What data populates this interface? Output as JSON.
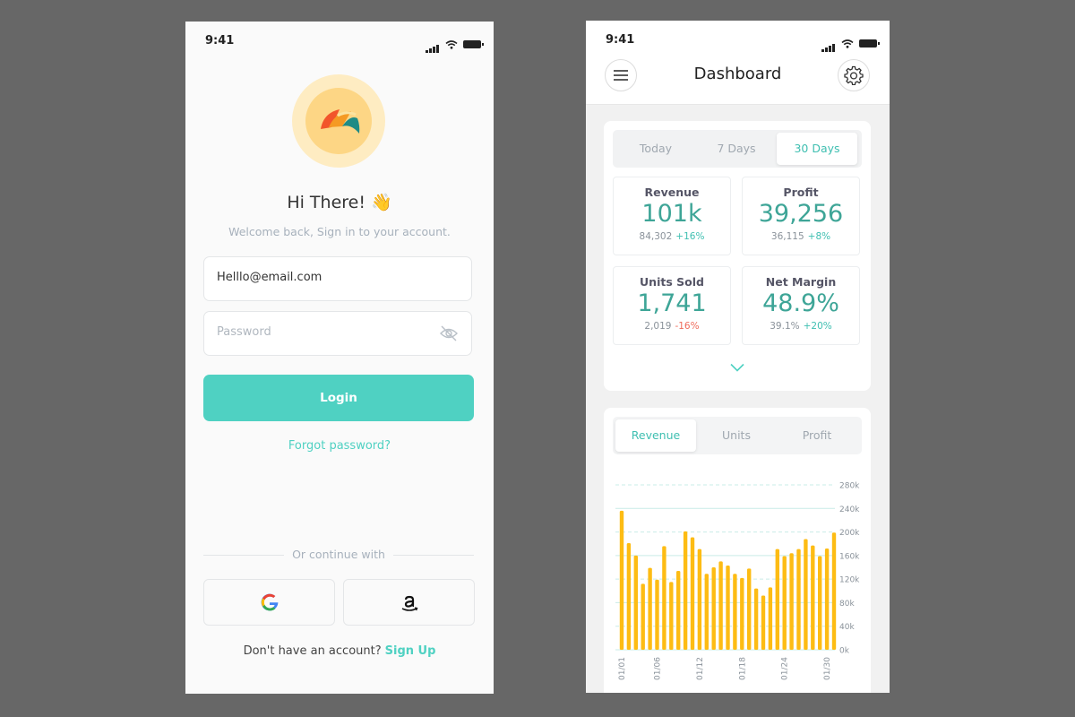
{
  "login": {
    "status": {
      "time": "9:41"
    },
    "greeting": "Hi There! 👋",
    "subtitle": "Welcome back, Sign in to your account.",
    "email_value": "Helllo@email.com",
    "password_placeholder": "Password",
    "login_label": "Login",
    "forgot_label": "Forgot password?",
    "divider_label": "Or continue with",
    "social": [
      "google-icon",
      "amazon-icon"
    ],
    "signup_prompt": "Don't have an account?",
    "signup_link": "Sign Up",
    "icons": {
      "password_toggle": "eye-off-icon"
    }
  },
  "dashboard": {
    "status": {
      "time": "9:41"
    },
    "title": "Dashboard",
    "icons": {
      "menu": "hamburger-menu-icon",
      "settings": "gear-icon",
      "expand": "chevron-down-icon"
    },
    "range_tabs": [
      "Today",
      "7 Days",
      "30 Days"
    ],
    "active_range": "30 Days",
    "stats": [
      {
        "label": "Revenue",
        "value": "101k",
        "previous": "84,302",
        "change": "+16%",
        "trend": "up"
      },
      {
        "label": "Profit",
        "value": "39,256",
        "previous": "36,115",
        "change": "+8%",
        "trend": "up"
      },
      {
        "label": "Units Sold",
        "value": "1,741",
        "previous": "2,019",
        "change": "-16%",
        "trend": "down"
      },
      {
        "label": "Net Margin",
        "value": "48.9%",
        "previous": "39.1%",
        "change": "+20%",
        "trend": "up"
      }
    ],
    "chart_tabs": [
      "Revenue",
      "Units",
      "Profit"
    ],
    "active_chart_tab": "Revenue"
  },
  "colors": {
    "accent": "#4fd1c2",
    "accent_dark": "#3ea597",
    "bar": "#fdbc14",
    "negative": "#ef6b5b"
  },
  "chart_data": {
    "type": "bar",
    "categories": [
      "01/01",
      "01/02",
      "01/03",
      "01/04",
      "01/05",
      "01/06",
      "01/07",
      "01/08",
      "01/09",
      "01/10",
      "01/11",
      "01/12",
      "01/13",
      "01/14",
      "01/15",
      "01/16",
      "01/17",
      "01/18",
      "01/19",
      "01/20",
      "01/21",
      "01/22",
      "01/23",
      "01/24",
      "01/25",
      "01/26",
      "01/27",
      "01/28",
      "01/29",
      "01/30"
    ],
    "x_tick_labels": [
      "01/01",
      "01/06",
      "01/12",
      "01/18",
      "01/24",
      "01/30"
    ],
    "values": [
      236000,
      181000,
      160000,
      112000,
      139000,
      119000,
      176000,
      115000,
      134000,
      201000,
      191000,
      171000,
      129000,
      140000,
      150000,
      143000,
      129000,
      122000,
      138000,
      104000,
      92000,
      106000,
      171000,
      159000,
      164000,
      171000,
      188000,
      177000,
      159000,
      172000,
      199000
    ],
    "y_ticks": [
      0,
      40000,
      80000,
      120000,
      160000,
      200000,
      240000,
      280000
    ],
    "y_tick_labels": [
      "0k",
      "40k",
      "80k",
      "120k",
      "160k",
      "200k",
      "240k",
      "280k"
    ],
    "ylim": [
      0,
      280000
    ],
    "grid": true,
    "legend": "none"
  }
}
